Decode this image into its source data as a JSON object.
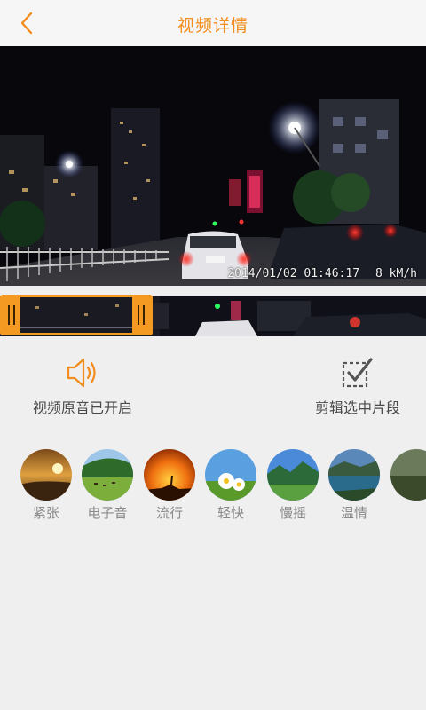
{
  "header": {
    "title": "视频详情"
  },
  "video": {
    "timestamp": "2014/01/02 01:46:17",
    "speed": "8 kM/h"
  },
  "actions": {
    "original_audio_label": "视频原音已开启",
    "clip_label": "剪辑选中片段"
  },
  "music": [
    {
      "label": "紧张",
      "icon": "sunset-thumbnail"
    },
    {
      "label": "电子音",
      "icon": "grassland-thumbnail"
    },
    {
      "label": "流行",
      "icon": "orange-sky-thumbnail"
    },
    {
      "label": "轻快",
      "icon": "daisy-thumbnail"
    },
    {
      "label": "慢摇",
      "icon": "green-hills-thumbnail"
    },
    {
      "label": "温情",
      "icon": "lake-thumbnail"
    },
    {
      "label": "",
      "icon": "partial-thumbnail"
    }
  ],
  "colors": {
    "accent": "#f28c1c",
    "background": "#efefef"
  }
}
